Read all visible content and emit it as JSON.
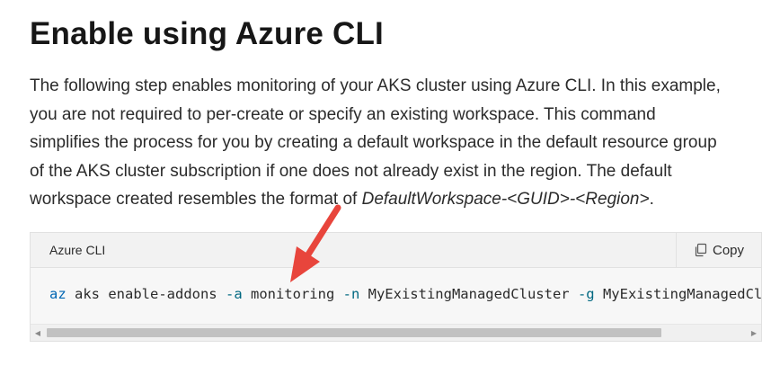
{
  "page": {
    "heading": "Enable using Azure CLI",
    "paragraph_lines": [
      "The following step enables monitoring of your AKS cluster using Azure CLI. In this example,",
      "you are not required to per-create or specify an existing workspace. This command",
      "simplifies the process for you by creating a default workspace in the default resource group",
      "of the AKS cluster subscription if one does not already exist in the region. The default"
    ],
    "paragraph_last_prefix": "workspace created resembles the format of ",
    "paragraph_last_emphasis": "DefaultWorkspace-<GUID>-<Region>",
    "paragraph_last_suffix": "."
  },
  "code_block": {
    "language_label": "Azure CLI",
    "copy_label": "Copy",
    "tokens": {
      "cmd": "az",
      "t1": " aks enable-addons ",
      "f1": "-a",
      "t2": " monitoring ",
      "f2": "-n",
      "t3": " MyExistingManagedCluster ",
      "f3": "-g",
      "t4": " MyExistingManagedClusterRG"
    },
    "scroll_visible_fraction": 0.88
  },
  "colors": {
    "annotation_arrow": "#e8453c",
    "command": "#0066b3",
    "flag": "#006881"
  },
  "icons": {
    "copy": "copy-icon",
    "scroll_left": "scroll-left-arrow-icon",
    "scroll_right": "scroll-right-arrow-icon",
    "annotation": "red-arrow-icon"
  }
}
